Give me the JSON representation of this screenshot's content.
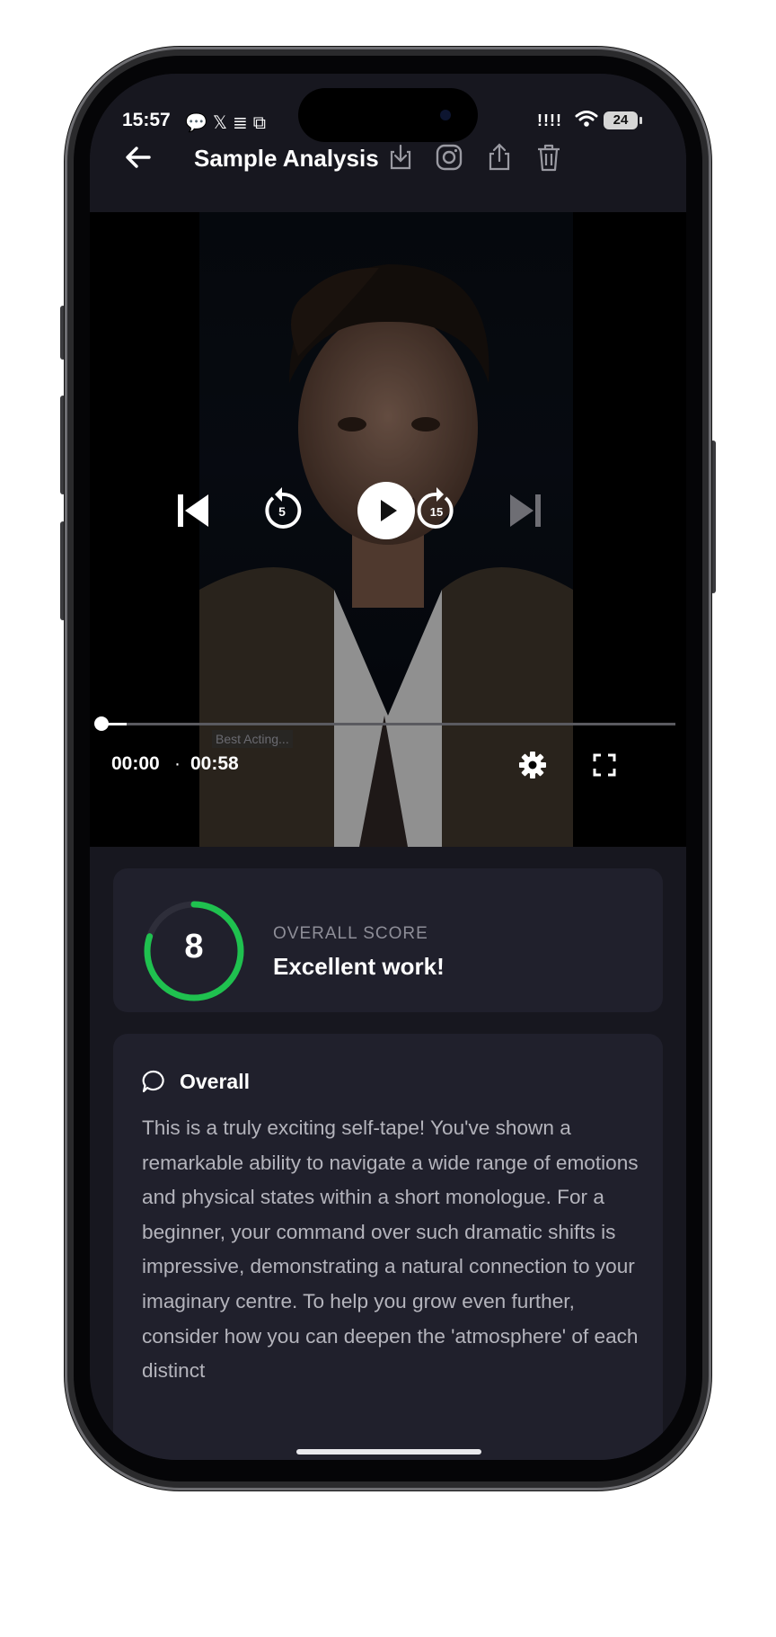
{
  "status_bar": {
    "time": "15:57",
    "notification_icons": "💬𝕏≣⧉",
    "signal": "!!!!",
    "battery": "24"
  },
  "header": {
    "title": "Sample Analysis",
    "icons": [
      "back-arrow-icon",
      "download-icon",
      "instagram-icon",
      "share-icon",
      "trash-icon"
    ]
  },
  "player": {
    "current_time": "00:00",
    "separator": "·",
    "duration": "00:58",
    "caption": "Best Acting...",
    "progress_fraction": 0.045,
    "skip_back_seconds": "5",
    "skip_forward_seconds": "15"
  },
  "score": {
    "value": "8",
    "max": 10,
    "label": "OVERALL SCORE",
    "message": "Excellent work!",
    "ring_color": "#1fc14f"
  },
  "overall": {
    "title": "Overall",
    "text": "This is a truly exciting self-tape! You've shown a remarkable ability to navigate a wide range of emotions and physical states within a short monologue. For a beginner, your command over such dramatic shifts is impressive, demonstrating a natural connection to your imaginary centre. To help you grow even further, consider how you can deepen the 'atmosphere' of each distinct"
  },
  "colors": {
    "background": "#17171f",
    "card": "#20202c",
    "accent": "#1fc14f"
  }
}
